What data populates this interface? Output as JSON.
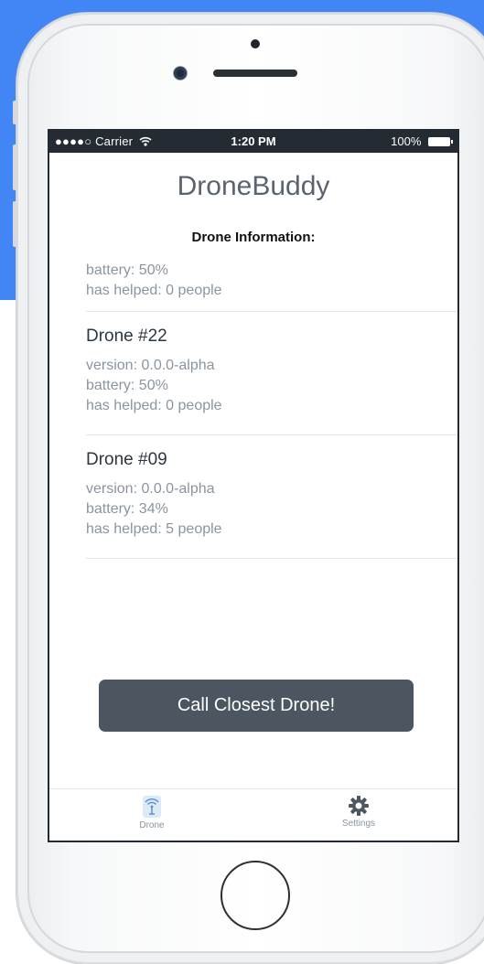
{
  "status_bar": {
    "carrier": "●●●●○ Carrier",
    "time": "1:20 PM",
    "battery": "100%",
    "wifi_icon": "wifi-icon",
    "battery_icon": "battery-icon"
  },
  "app": {
    "title": "DroneBuddy",
    "section_heading": "Drone Information:"
  },
  "drones": [
    {
      "name": "",
      "version": "",
      "battery": "battery: 50%",
      "helped": "has helped: 0 people"
    },
    {
      "name": "Drone #22",
      "version": "version: 0.0.0-alpha",
      "battery": "battery: 50%",
      "helped": "has helped: 0 people"
    },
    {
      "name": "Drone #09",
      "version": "version: 0.0.0-alpha",
      "battery": "battery: 34%",
      "helped": "has helped: 5 people"
    }
  ],
  "call_button": {
    "label": "Call Closest Drone!"
  },
  "tabbar": {
    "tabs": [
      {
        "label": "Drone",
        "icon": "drone-signal-icon",
        "active": true
      },
      {
        "label": "Settings",
        "icon": "gear-icon",
        "active": false
      }
    ]
  },
  "colors": {
    "background_accent": "#4285f4",
    "button": "#4b5661",
    "status_bar": "#242b33",
    "muted_text": "#8a95a1"
  }
}
